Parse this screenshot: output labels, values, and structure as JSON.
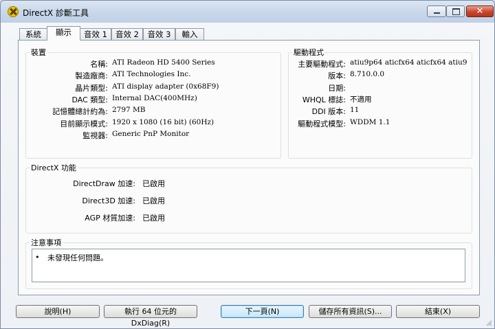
{
  "window": {
    "title": "DirectX 診斷工具"
  },
  "tabs": [
    {
      "label": "系統"
    },
    {
      "label": "顯示"
    },
    {
      "label": "音效 1"
    },
    {
      "label": "音效 2"
    },
    {
      "label": "音效 3"
    },
    {
      "label": "輸入"
    }
  ],
  "device": {
    "title": "裝置",
    "rows": [
      {
        "label": "名稱:",
        "value": "ATI Radeon HD 5400 Series"
      },
      {
        "label": "製造廠商:",
        "value": "ATI Technologies Inc."
      },
      {
        "label": "晶片類型:",
        "value": "ATI display adapter (0x68F9)"
      },
      {
        "label": "DAC 類型:",
        "value": "Internal DAC(400MHz)"
      },
      {
        "label": "記憶體總計約為:",
        "value": "2797 MB"
      },
      {
        "label": "目前顯示模式:",
        "value": "1920 x 1080 (16 bit) (60Hz)"
      },
      {
        "label": "監視器:",
        "value": "Generic PnP Monitor"
      }
    ]
  },
  "driver": {
    "title": "驅動程式",
    "rows": [
      {
        "label": "主要驅動程式:",
        "value": "atiu9p64 aticfx64 aticfx64 atiu9pag"
      },
      {
        "label": "版本:",
        "value": "8.710.0.0"
      },
      {
        "label": "日期:",
        "value": ""
      },
      {
        "label": "WHQL 標誌:",
        "value": "不適用"
      },
      {
        "label": "DDI 版本:",
        "value": "11"
      },
      {
        "label": "驅動程式模型:",
        "value": "WDDM 1.1"
      }
    ]
  },
  "directx": {
    "title": "DirectX 功能",
    "rows": [
      {
        "label": "DirectDraw 加速:",
        "value": "已啟用"
      },
      {
        "label": "Direct3D 加速:",
        "value": "已啟用"
      },
      {
        "label": "AGP 材質加速:",
        "value": "已啟用"
      }
    ]
  },
  "notes": {
    "title": "注意事項",
    "items": [
      {
        "bullet": "•",
        "text": "未發現任何問題。"
      }
    ]
  },
  "buttons": {
    "help": "說明(H)",
    "run64": "執行 64 位元的 DxDiag(R)",
    "next": "下一頁(N)",
    "save": "儲存所有資訊(S)...",
    "exit": "結束(X)"
  },
  "colors": {
    "titlebar": "#c9d8ea",
    "close_button": "#c9462c",
    "panel": "#fbfbfb"
  }
}
